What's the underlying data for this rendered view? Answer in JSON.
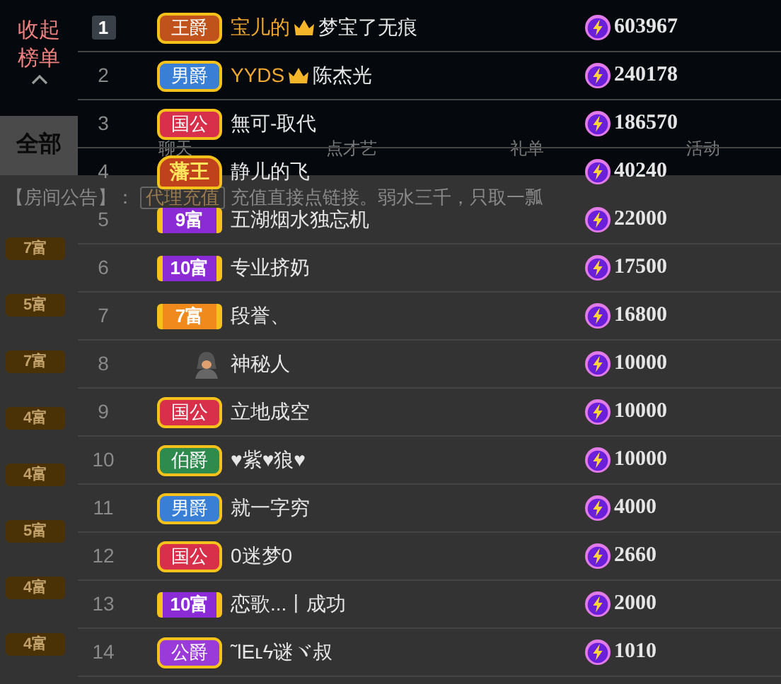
{
  "tabs": [
    {
      "label": "全部",
      "selected": true
    },
    {
      "label": "聊天",
      "selected": false
    },
    {
      "label": "点才艺",
      "selected": false
    },
    {
      "label": "礼单",
      "selected": false
    },
    {
      "label": "活动",
      "selected": false
    }
  ],
  "announcement": {
    "label": "【房间公告】：",
    "button": "代理充值",
    "text": "充值直接点链接。弱水三千，只取一瓢"
  },
  "chat_levels": [
    "7富",
    "5富",
    "7富",
    "4富",
    "4富",
    "5富",
    "4富",
    "4富"
  ],
  "collapse": {
    "label": "收起榜单"
  },
  "ranking": [
    {
      "rank": "1",
      "badge": {
        "kind": "title",
        "label": "王爵",
        "color": "#c0521c"
      },
      "guard_name": "宝儿的",
      "name": "梦宝了无痕",
      "score": "603967"
    },
    {
      "rank": "2",
      "badge": {
        "kind": "title",
        "label": "男爵",
        "color": "#3a7fd6"
      },
      "guard_name": "YYDS",
      "name": "陈杰光",
      "score": "240178"
    },
    {
      "rank": "3",
      "badge": {
        "kind": "title",
        "label": "国公",
        "color": "#d8304a"
      },
      "name": "無可-取代",
      "score": "186570"
    },
    {
      "rank": "4",
      "badge": {
        "kind": "crown",
        "label": "藩王",
        "color": "#c0421c"
      },
      "name": "静儿的飞",
      "score": "40240"
    },
    {
      "rank": "5",
      "badge": {
        "kind": "wealth",
        "label": "9富",
        "color": "#8a2bd6"
      },
      "name": "五湖烟水独忘机",
      "score": "22000"
    },
    {
      "rank": "6",
      "badge": {
        "kind": "wealth",
        "label": "10富",
        "color": "#8a2bd6"
      },
      "name": "专业挤奶",
      "score": "17500"
    },
    {
      "rank": "7",
      "badge": {
        "kind": "wealth",
        "label": "7富",
        "color": "#f08a1c"
      },
      "name": "段誉、",
      "score": "16800"
    },
    {
      "rank": "8",
      "badge": {
        "kind": "mystery"
      },
      "name": "神秘人",
      "score": "10000"
    },
    {
      "rank": "9",
      "badge": {
        "kind": "title",
        "label": "国公",
        "color": "#d8304a"
      },
      "name": "立地成空",
      "score": "10000"
    },
    {
      "rank": "10",
      "badge": {
        "kind": "title",
        "label": "伯爵",
        "color": "#2f8a4e"
      },
      "name": "♥紫♥狼♥",
      "score": "10000"
    },
    {
      "rank": "11",
      "badge": {
        "kind": "title",
        "label": "男爵",
        "color": "#3a7fd6"
      },
      "name": "就一字穷",
      "score": "4000"
    },
    {
      "rank": "12",
      "badge": {
        "kind": "title",
        "label": "国公",
        "color": "#d8304a"
      },
      "name": "0迷梦0",
      "score": "2660"
    },
    {
      "rank": "13",
      "badge": {
        "kind": "wealth",
        "label": "10富",
        "color": "#8a2bd6"
      },
      "name": "恋歌...丨成功",
      "score": "2000"
    },
    {
      "rank": "14",
      "badge": {
        "kind": "title",
        "label": "公爵",
        "color": "#9a3ad8"
      },
      "name": "῀ƖEʟϟ谜ヾ叔",
      "score": "1010"
    }
  ]
}
